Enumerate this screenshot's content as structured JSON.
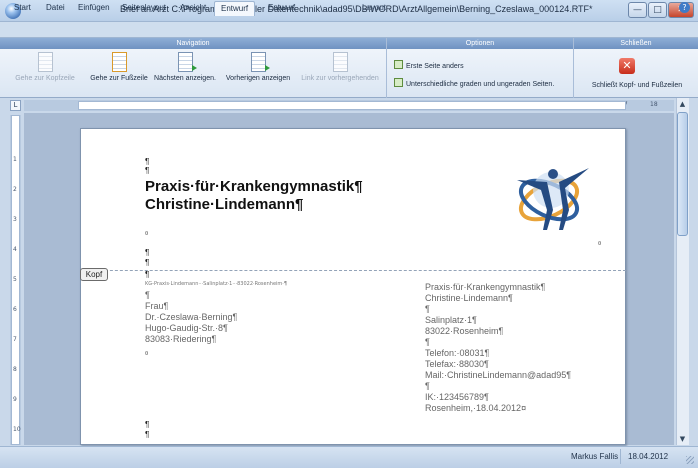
{
  "window": {
    "title": "Brief an Arzt C:\\Program Files\\Ridler Datentechnik\\adad95\\DB\\WORD\\ArztAllgemein\\Berning_Czeslawa_000124.RTF*",
    "minimize": "—",
    "maximize": "□",
    "close": "✕"
  },
  "tabs": [
    {
      "label": "Start"
    },
    {
      "label": "Datei"
    },
    {
      "label": "Einfügen"
    },
    {
      "label": "Seitenlayout"
    },
    {
      "label": "Ansicht"
    },
    {
      "label": "Entwurf"
    },
    {
      "label": "Entwurf"
    },
    {
      "label": "Layout"
    }
  ],
  "ribbon": {
    "groups": {
      "navigation": "Navigation",
      "optionen": "Optionen",
      "schliessen": "Schließen"
    },
    "nav_buttons": [
      {
        "label": "Gehe zur Kopfzeile",
        "enabled": false
      },
      {
        "label": "Gehe zur Fußzeile",
        "enabled": true
      },
      {
        "label": "Nächsten anzeigen.",
        "enabled": true
      },
      {
        "label": "Vorherigen anzeigen",
        "enabled": true
      },
      {
        "label": "Link zur vorhergehenden",
        "enabled": false
      }
    ],
    "options": [
      "Erste Seite anders",
      "Unterschiedliche graden und ungeraden Seiten."
    ],
    "close_label": "Schließt Kopf- und Fußzeilen",
    "close_glyph": "✕"
  },
  "ruler": {
    "corner": "L",
    "h_ticks": [
      "2",
      "1",
      "1",
      "2",
      "3",
      "4",
      "5",
      "6",
      "7",
      "8",
      "9",
      "10",
      "11",
      "12",
      "13",
      "14",
      "15",
      "16",
      "17",
      "18"
    ],
    "v_ticks": [
      "1",
      "2",
      "3",
      "4",
      "5",
      "6",
      "7",
      "8",
      "9",
      "10"
    ]
  },
  "document": {
    "header_tag": "Kopf",
    "pilcrow": "¶",
    "cell_mark": "¤",
    "praxis_name": "Praxis·für·Krankengymnastik¶",
    "praxis_person": "Christine·Lindemann¶",
    "sender_line": "KG-Praxis·Lindemann···Salinplatz·1···83022·Rosenheim·¶",
    "recipient": [
      "¶",
      "Frau¶",
      "Dr.·Czeslawa·Berning¶",
      "Hugo-Gaudig-Str.·8¶",
      "83083·Riedering¶"
    ],
    "sender_block": [
      "Praxis·für·Krankengymnastik¶",
      "Christine·Lindemann¶",
      "¶",
      "Salinplatz·1¶",
      "83022·Rosenheim¶",
      "¶",
      "Telefon:·08031¶",
      "Telefax:·88030¶",
      "Mail:·ChristineLindemann@adad95¶",
      "¶",
      "IK:·123456789¶",
      "Rosenheim,·18.04.2012¤"
    ]
  },
  "statusbar": {
    "user": "Markus Fallis",
    "date": "18.04.2012"
  },
  "colors": {
    "ribbon_group_header": "#7c9ccb",
    "logo_orange": "#e8a33a",
    "logo_blue": "#2e5f9e"
  }
}
